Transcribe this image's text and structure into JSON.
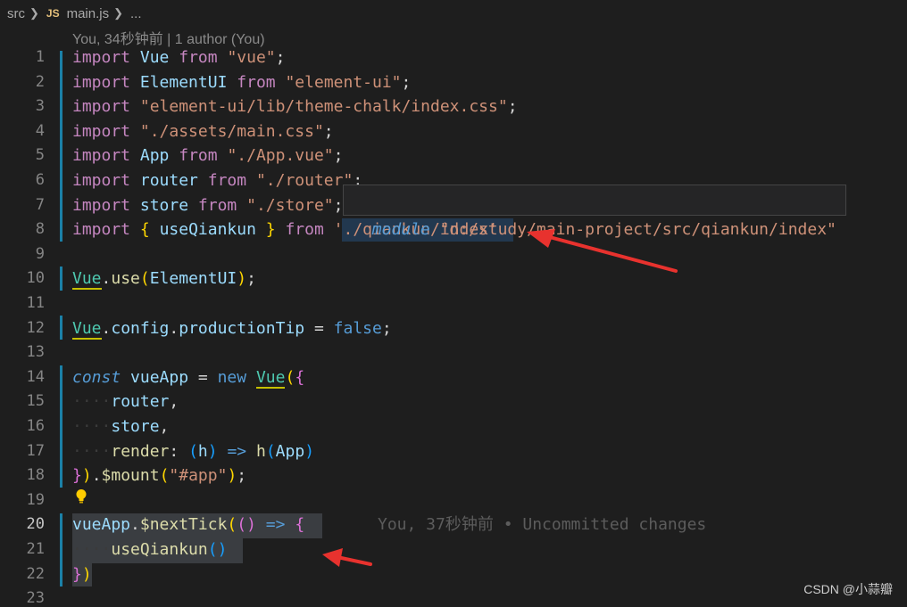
{
  "breadcrumb": {
    "folder": "src",
    "file_icon": "JS",
    "file": "main.js",
    "more": "..."
  },
  "codelens": "You, 34秒钟前 | 1 author (You)",
  "lines": [
    {
      "num": "1"
    },
    {
      "num": "2"
    },
    {
      "num": "3"
    },
    {
      "num": "4"
    },
    {
      "num": "5"
    },
    {
      "num": "6"
    },
    {
      "num": "7"
    },
    {
      "num": "8"
    },
    {
      "num": "9"
    },
    {
      "num": "10"
    },
    {
      "num": "11"
    },
    {
      "num": "12"
    },
    {
      "num": "13"
    },
    {
      "num": "14"
    },
    {
      "num": "15"
    },
    {
      "num": "16"
    },
    {
      "num": "17"
    },
    {
      "num": "18"
    },
    {
      "num": "19"
    },
    {
      "num": "20"
    },
    {
      "num": "21"
    },
    {
      "num": "22"
    },
    {
      "num": "23"
    }
  ],
  "tooltip": {
    "keyword": "module",
    "path": "\"d:/study/main-project/src/qiankun/index\""
  },
  "blame": "You, 37秒钟前 • Uncommitted changes",
  "watermark": "CSDN @小蒜瓣",
  "colors": {
    "keyword": "#c586c0",
    "string": "#ce9178",
    "variable": "#9cdcfe",
    "type": "#4ec9b0",
    "function": "#dcdcaa",
    "annotation_arrow": "#e8322e"
  }
}
